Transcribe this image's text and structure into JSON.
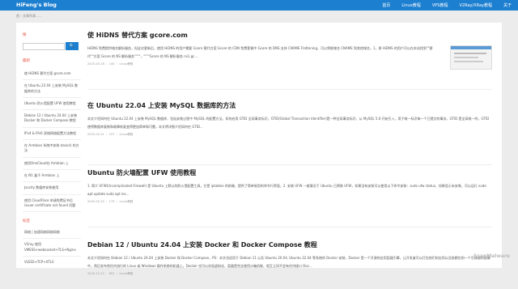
{
  "nav": {
    "brand": "HiFeng's Blog",
    "links": [
      "首页",
      "Linux教程",
      "VPS教程",
      "V2Ray/XRay教程",
      "关于"
    ]
  },
  "breadcrumb": "首 › 文章列表……",
  "sidebar": {
    "search_title": "搜",
    "search_placeholder": "",
    "search_btn": "🔍",
    "recent_title": "最新",
    "items": [
      "使 HiDNS 替代方案 gcore.com",
      "在 Ubuntu 22.04 上安装 MySQL 数据库的方法",
      "Ubuntu 防火墙配置 UFW 使用教程",
      "Debian 12 / Ubuntu 24.04 上安装 Docker 和 Docker Compose 教程",
      "IPv4 & IPv6 双栈网络配置方法教程",
      "在 Armbian 系统中安装 das(ol) 的方法",
      "使用OneCloud在 Armbian 上",
      "在 N1 盒子 Armbian 上",
      "Jsocity 数据库安装使用",
      "使用 CloudFlare 申请免费证书后 issuer certificate not found 问题"
    ],
    "tags_title": "标签",
    "tags_text": "网络 | 加速网络网络网络",
    "extra_items": [
      "V2ray 使用 VMESS+websocket+TLS+Nginx",
      "VLESS+TCP+XTLS"
    ]
  },
  "posts": [
    {
      "title": "使 HiDNS 替代方案 gcore.com",
      "excerpt": "HiDNS 免费提供域名解析服务，但这次更新后，使用 HiDNS 的用户需要 Gcore 替代方案 Gcore 的 CDN 免费套餐中 Gcore 的 DNS 支持 CNAME Flattening，可以将根域名 CNAME 到其他域名，1，原 HiDNS 的用户可以在本站找到\"\"替代\"\"方案 Gcore 的 NS 解析服务\"\"\"\"，\"\"\"\"Gcore 的 NS 解析服务 ns1.gc...",
      "date": "2025-03-18",
      "views": "140",
      "category": "Linux教程",
      "has_thumb": true
    },
    {
      "title": "在 Ubuntu 22.04 上安装 MySQL 数据库的方法",
      "excerpt": "本文介绍如何在 Ubuntu 22.04 上安装 MySQL 数据库，包括安装过程中 MySQL 的配置方法，如何启用 GTID 全局事务标识，GTID(Global Transaction Identifier)是一种全局事务标识，从 MySQL 5.6 开始引入，用于唯一标识每一个已提交的事务，GTID 是全局唯一的，GTID 使得数据库复制和故障恢复变得更加简单和可靠，本文将详细介绍如何在 GTID...",
      "date": "2025-02-21",
      "views": "157",
      "category": "Linux教程",
      "has_thumb": false
    },
    {
      "title": "Ubuntu 防火墙配置 UFW 使用教程",
      "excerpt": "1. 简介 UFW(Uncomplicated Firewall) 是 Ubuntu 上默认的防火墙配置工具，它是 iptables 的前端，提供了简单易用的命令行界面，2. 安装 UFW 一般情况下 Ubuntu 已预装 UFW，如果没有安装可以使用以下命令安装：sudo ufw status，如果显示未安装，可以运行 sudo apt update sudo apt ins...",
      "date": "2025-02-20",
      "views": "179",
      "category": "Linux教程",
      "has_thumb": false
    },
    {
      "title": "Debian 12 / Ubuntu 24.04 上安装 Docker 和 Docker Compose 教程",
      "excerpt": "本文介绍如何在 Debian 12 / Ubuntu 24.04 上安装 Docker 和 Docker Compose，PS：本文也适用于 Debian 11 以及 Ubuntu 20.04, Ubuntu 22.04 等系统的 Docker 安装，Docker 是一个开源的应用容器引擎，让开发者可以打包他们的应用以及依赖包到一个可移植的镜像中，然后发布到任何流行的 Linux 或 Windows 操作系统的机器上。Docker 也可以实现虚拟化，容器是完全使用沙箱机制，相互之间不会有任何接口 Doc...",
      "date": "2024-11-22",
      "views": "801",
      "category": "Linux教程",
      "has_thumb": false
    }
  ],
  "watermark": "ScanMalware"
}
